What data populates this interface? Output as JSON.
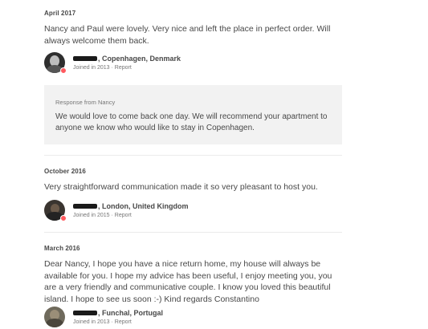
{
  "reviews": [
    {
      "date": "April 2017",
      "text": "Nancy and Paul were lovely. Very nice and left the place in perfect order. Will always welcome them back.",
      "author": {
        "location": ", Copenhagen, Denmark",
        "joined": "Joined in 2013",
        "separator": " · ",
        "report": "Report"
      },
      "response": {
        "label": "Response from Nancy",
        "text": "We would love to come back one day. We will recommend your apartment to anyone we know who would like to stay in Copenhagen."
      }
    },
    {
      "date": "October 2016",
      "text": "Very straightforward communication made it so very pleasant to host you.",
      "author": {
        "location": ", London, United Kingdom",
        "joined": "Joined in 2015",
        "separator": " · ",
        "report": "Report"
      }
    },
    {
      "date": "March 2016",
      "text": "Dear Nancy, I hope you have a nice return home, my house will always be available for you. I hope my advice has been useful, I enjoy meeting you, you are a very friendly and communicative couple. I know you loved this beautiful island. I hope to see us soon :-) Kind regards Constantino",
      "author": {
        "location": ", Funchal, Portugal",
        "joined": "Joined in 2013",
        "separator": " · ",
        "report": "Report"
      }
    }
  ],
  "colors": {
    "accent": "#ff5a5f",
    "response_bg": "#f2f2f2",
    "text": "#484848",
    "muted": "#767676"
  }
}
